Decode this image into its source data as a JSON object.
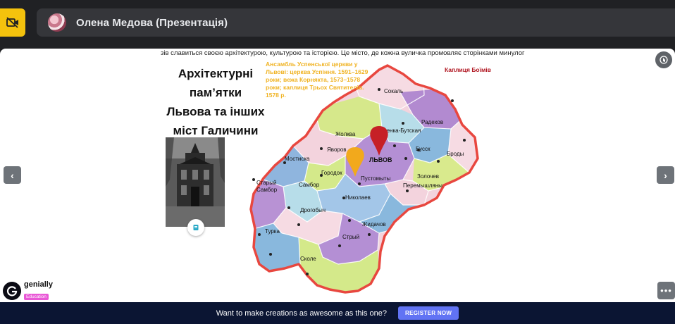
{
  "topbar": {
    "camera_icon": "video-off-icon",
    "presenter_title": "Олена Медова (Презентація)"
  },
  "slide": {
    "marquee_text": "зів славиться своєю архітектурою, культурою та історією. Це місто, де кожна вуличка промовляє сторінками минулог",
    "title": "Архітектурні пам’ятки Львова та інших міст Галичини",
    "annotation": "Ансамбль Успенської церкви у Львові: церква Успіння. 1591–1629 роки; вежа Корнякта, 1573–1578 роки; каплиця Трьох Святителів. 1578 р.",
    "chapel_label": "Каплиця Боїмів",
    "map_cities": {
      "sokal": "Сокаль",
      "radekhov": "Радехов",
      "kamenka": "Каменка-Бутская",
      "zholkva": "Жолква",
      "busk": "Бусск",
      "brody": "Броды",
      "yavorov": "Яворов",
      "mostiska": "Мостиска",
      "lviv": "ЛЬВОВ",
      "gorodok": "Городок",
      "pustomyty": "Пустомыты",
      "zolochev": "Золочев",
      "peremyshlyany": "Перемышляны",
      "stary_sambor": "Старый Самбор",
      "sambor": "Самбор",
      "nikolaev": "Николаев",
      "drogobych": "Дрогобыч",
      "zhidachov": "Жидачов",
      "turka": "Турка",
      "stryi": "Стрый",
      "skole": "Сколе"
    }
  },
  "colors": {
    "accent_yellow": "#f4c20d",
    "pin_red": "#c62026",
    "pin_yellow": "#f2a91c",
    "map_border": "#e8473f",
    "register_button": "#6173f4"
  },
  "branding": {
    "name": "genially",
    "tag": "Education"
  },
  "footer": {
    "promo_text": "Want to make creations as awesome as this one?",
    "register_label": "REGISTER NOW"
  },
  "nav": {
    "prev_icon": "chevron-left-icon",
    "next_icon": "chevron-right-icon",
    "more_icon": "more-horizontal-icon",
    "corner_icon": "touch-icon"
  }
}
